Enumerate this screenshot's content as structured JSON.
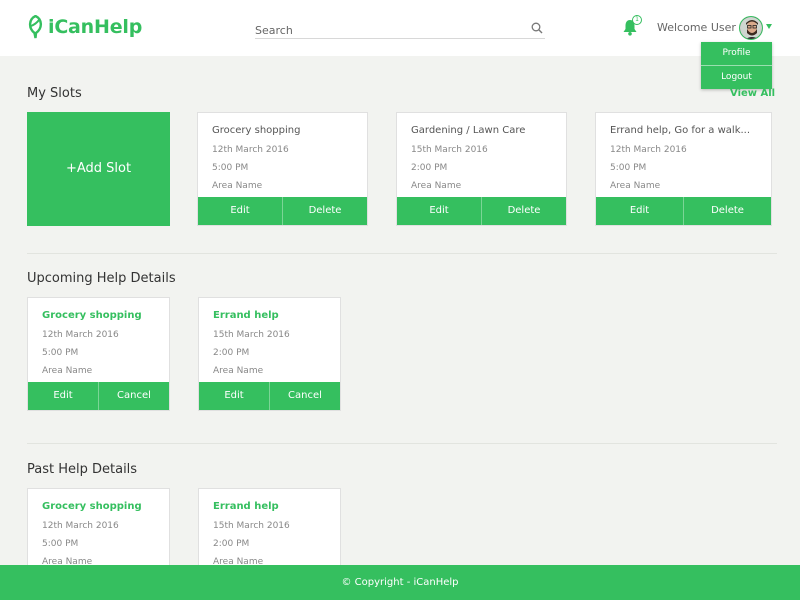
{
  "header": {
    "brand": "iCanHelp",
    "search_placeholder": "Search",
    "notification_count": "1",
    "welcome": "Welcome User"
  },
  "dropdown": {
    "items": [
      "Profile",
      "Logout"
    ]
  },
  "my_slots": {
    "title": "My Slots",
    "view_all": "View All",
    "add_label": "+Add Slot",
    "cards": [
      {
        "title": "Grocery shopping",
        "date": "12th March 2016",
        "time": "5:00 PM",
        "area": "Area Name",
        "edit": "Edit",
        "delete": "Delete"
      },
      {
        "title": "Gardening / Lawn Care",
        "date": "15th March 2016",
        "time": "2:00 PM",
        "area": "Area Name",
        "edit": "Edit",
        "delete": "Delete"
      },
      {
        "title": "Errand help, Go for a walk...",
        "date": "12th March 2016",
        "time": "5:00 PM",
        "area": "Area Name",
        "edit": "Edit",
        "delete": "Delete"
      }
    ]
  },
  "upcoming": {
    "title": "Upcoming Help Details",
    "cards": [
      {
        "title": "Grocery shopping",
        "date": "12th March 2016",
        "time": "5:00 PM",
        "area": "Area Name",
        "edit": "Edit",
        "cancel": "Cancel"
      },
      {
        "title": "Errand help",
        "date": "15th March 2016",
        "time": "2:00 PM",
        "area": "Area Name",
        "edit": "Edit",
        "cancel": "Cancel"
      }
    ]
  },
  "past": {
    "title": "Past Help Details",
    "cards": [
      {
        "title": "Grocery shopping",
        "date": "12th March 2016",
        "time": "5:00 PM",
        "area": "Area Name"
      },
      {
        "title": "Errand help",
        "date": "15th March 2016",
        "time": "2:00 PM",
        "area": "Area Name"
      }
    ]
  },
  "footer": {
    "text": "© Copyright - iCanHelp"
  },
  "colors": {
    "accent": "#35bf5f",
    "background": "#f2f3f0"
  }
}
